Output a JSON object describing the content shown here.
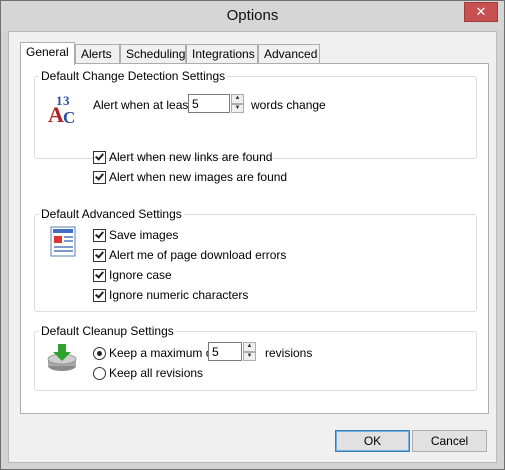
{
  "window": {
    "title": "Options",
    "close_glyph": "✕"
  },
  "tabs": [
    {
      "label": "General",
      "selected": true
    },
    {
      "label": "Alerts",
      "selected": false
    },
    {
      "label": "Scheduling",
      "selected": false
    },
    {
      "label": "Integrations",
      "selected": false
    },
    {
      "label": "Advanced",
      "selected": false
    }
  ],
  "change_detection": {
    "title": "Default Change Detection Settings",
    "icon": "spelling-abc-icon",
    "alert_prefix": "Alert when at least",
    "alert_value": "5",
    "alert_suffix": "words change",
    "links_label": "Alert when new links are found",
    "links_checked": true,
    "images_label": "Alert when new images are found",
    "images_checked": true
  },
  "advanced": {
    "title": "Default Advanced Settings",
    "icon": "web-page-icon",
    "save_images_label": "Save images",
    "save_images_checked": true,
    "download_errors_label": "Alert me of page download errors",
    "download_errors_checked": true,
    "ignore_case_label": "Ignore case",
    "ignore_case_checked": true,
    "ignore_numeric_label": "Ignore numeric characters",
    "ignore_numeric_checked": true
  },
  "cleanup": {
    "title": "Default Cleanup Settings",
    "icon": "disk-download-icon",
    "keep_max_label": "Keep a maximum of",
    "keep_max_selected": true,
    "revisions_value": "5",
    "revisions_label": "revisions",
    "keep_all_label": "Keep all revisions",
    "keep_all_selected": false
  },
  "buttons": {
    "ok": "OK",
    "cancel": "Cancel"
  },
  "colors": {
    "close_button": "#c75050",
    "default_button_border": "#3c7fb1"
  }
}
